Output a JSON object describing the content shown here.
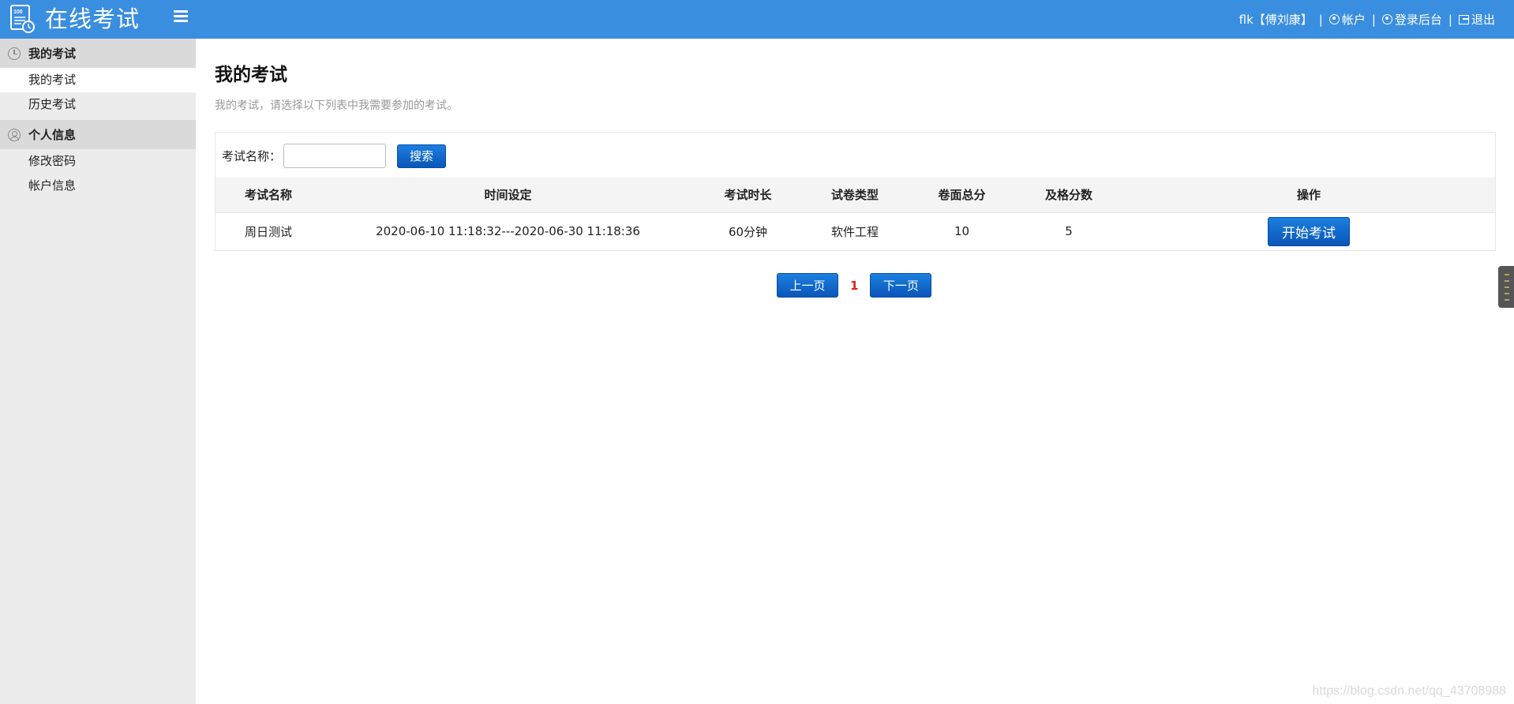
{
  "header": {
    "logo_text": "100",
    "app_title": "在线考试",
    "user_label": "flk【傅刘康】",
    "account_link": "帐户",
    "admin_link": "登录后台",
    "logout_link": "退出"
  },
  "sidebar": {
    "groups": [
      {
        "title": "我的考试",
        "icon": "clock-icon",
        "items": [
          {
            "label": "我的考试"
          },
          {
            "label": "历史考试"
          }
        ]
      },
      {
        "title": "个人信息",
        "icon": "user-icon",
        "items": [
          {
            "label": "修改密码"
          },
          {
            "label": "帐户信息"
          }
        ]
      }
    ]
  },
  "main": {
    "title": "我的考试",
    "description": "我的考试，请选择以下列表中我需要参加的考试。",
    "search": {
      "label": "考试名称：",
      "value": "",
      "placeholder": "",
      "button": "搜索"
    },
    "table": {
      "headers": [
        "考试名称",
        "时间设定",
        "考试时长",
        "试卷类型",
        "卷面总分",
        "及格分数",
        "操作"
      ],
      "rows": [
        {
          "name": "周日测试",
          "time": "2020-06-10 11:18:32---2020-06-30 11:18:36",
          "duration": "60分钟",
          "type": "软件工程",
          "total": "10",
          "pass": "5",
          "action": "开始考试"
        }
      ]
    },
    "pagination": {
      "prev": "上一页",
      "current": "1",
      "next": "下一页"
    }
  },
  "watermark": "https://blog.csdn.net/qq_43708988",
  "colors": {
    "topbar": "#3a8ee0",
    "button": "#0b63c8",
    "current_page": "#e0201e"
  }
}
